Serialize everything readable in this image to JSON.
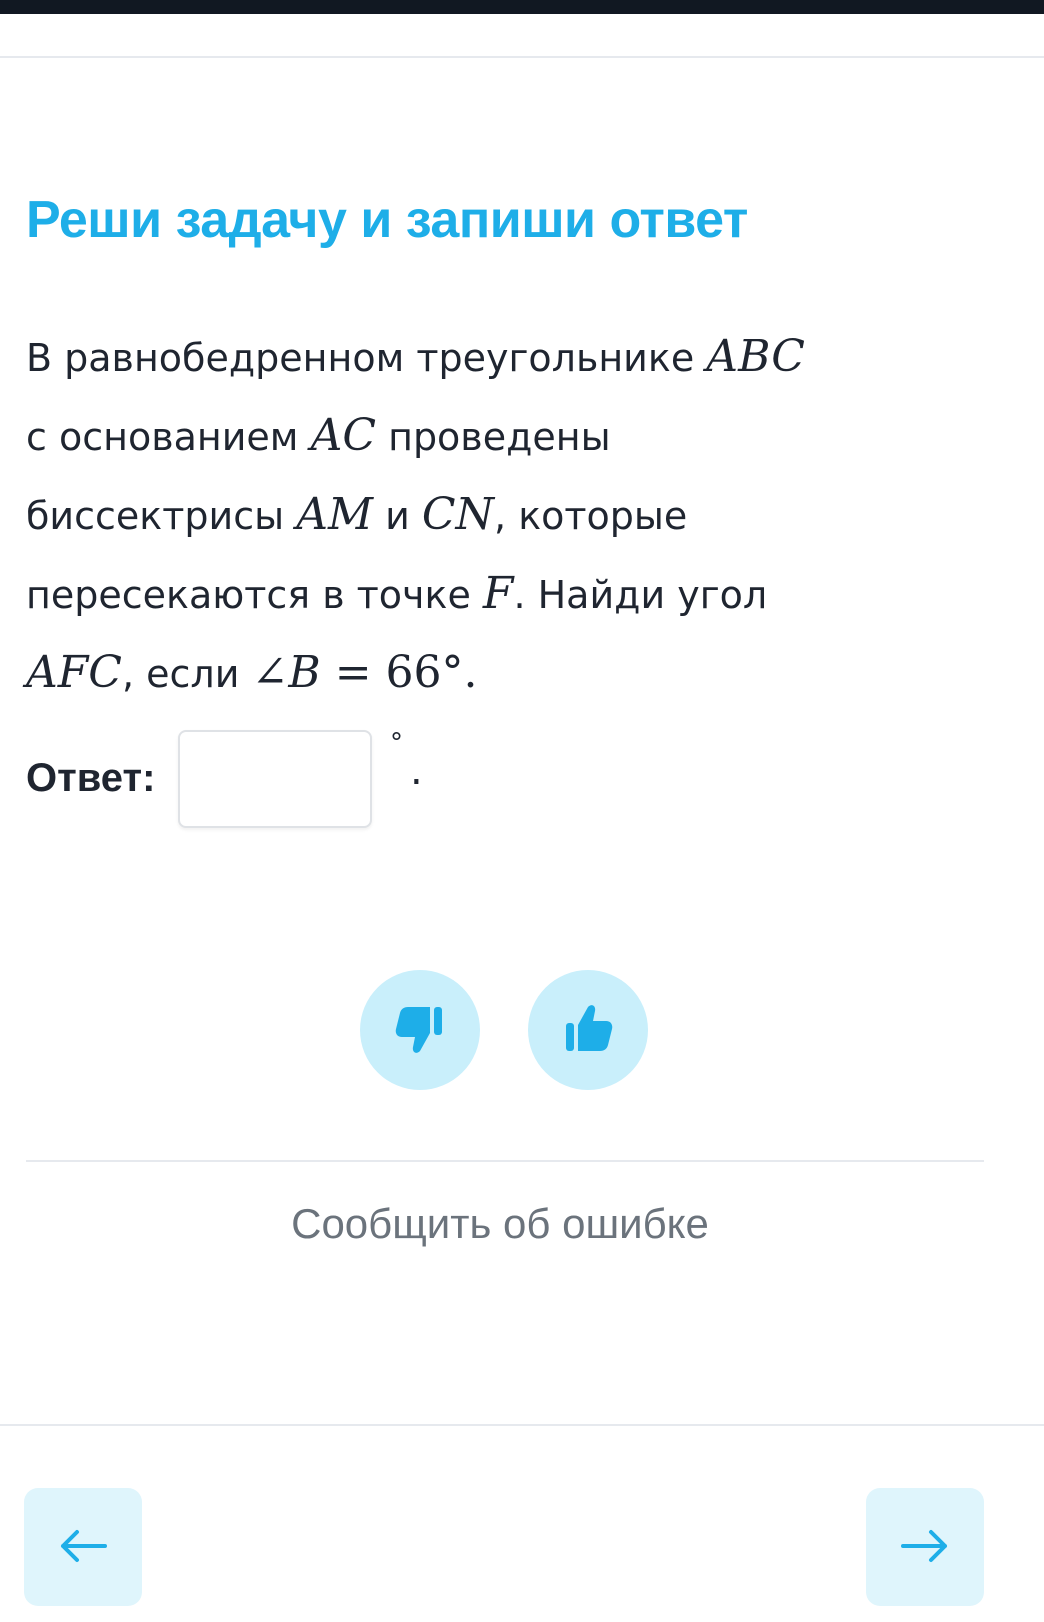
{
  "task": {
    "title": "Реши задачу и запиши ответ",
    "problem": {
      "t1": "В равнобедренном треугольнике ",
      "m1": "ABC",
      "t2": "с основанием ",
      "m2": "AC",
      "t3": " проведены",
      "t4": "биссектрисы ",
      "m3": "AM",
      "t5": " и ",
      "m4": "CN",
      "t6": ", которые",
      "t7": "пересекаются в точке ",
      "m5": "F",
      "t8": ". Найди угол",
      "m6": "AFC",
      "t9": ", если ",
      "angle": "∠",
      "m7": "B",
      "eq": " = ",
      "num": "66",
      "deg": "°",
      "end": "."
    }
  },
  "answer": {
    "label": "Ответ:",
    "value": "",
    "unit_degree": "°",
    "unit_period": "."
  },
  "feedback": {
    "dislike_icon": "thumbs-down-icon",
    "like_icon": "thumbs-up-icon",
    "icon_color": "#1eaee8",
    "button_bg": "#c9effb"
  },
  "report_error": "Сообщить об ошибке",
  "navigation": {
    "prev_icon": "arrow-left-icon",
    "next_icon": "arrow-right-icon"
  },
  "colors": {
    "accent": "#1eaee8",
    "text": "#1f2530",
    "muted": "#6b737c",
    "topbar": "#111822"
  }
}
